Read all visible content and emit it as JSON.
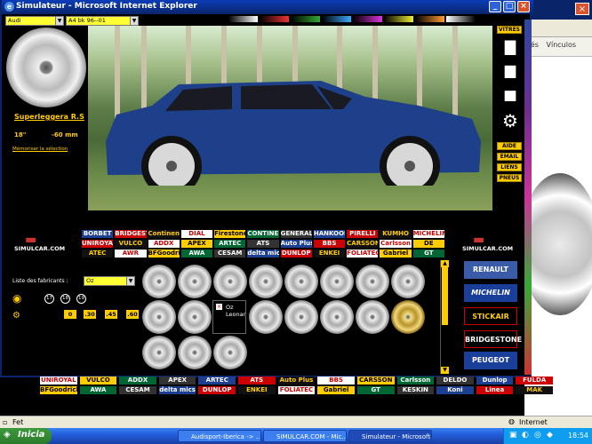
{
  "window": {
    "title": "Simulateur - Microsoft Internet Explorer",
    "minimize": "_",
    "maximize": "□",
    "close": "×"
  },
  "bg_browser": {
    "link1": "Vés",
    "link2": "Vínculos"
  },
  "top_selects": {
    "make": "Audi",
    "model": "A4 bk 96--01"
  },
  "wheel_info": {
    "name": "Superleggera R.S",
    "size": "18\"",
    "offset": "-60 mm",
    "memorize_link": "Mémoriser la sélection"
  },
  "right_menu": {
    "vitres": "VITRES",
    "aide": "AIDE",
    "email": "EMAIL",
    "liens": "LIENS",
    "pneus": "PNEUS"
  },
  "site_logo": "SIMULCAR.COM",
  "site_logo_right": "SIMULCAR.COM",
  "manufacturers": {
    "label": "Liste des fabricants :",
    "selected": "Oz",
    "rim_sizes": [
      "17",
      "18",
      "19"
    ],
    "offsets": [
      "0",
      ".30",
      ".45",
      ".60"
    ]
  },
  "wheel_missing_label": "Oz Leonar",
  "logo_rows": [
    [
      "BORBET",
      "BRIDGESTONE",
      "Continental",
      "DIAL",
      "Firestone",
      "CONTINENTAL",
      "GENERAL TIRE",
      "HANKOOK",
      "PIRELLI",
      "KUMHO",
      "MICHELIN"
    ],
    [
      "UNIROYAL",
      "VULCO",
      "ADDX",
      "APEX",
      "ARTEC",
      "ATS",
      "Auto Plus",
      "BBS",
      "CARSSON",
      "Carlsson",
      "DE"
    ],
    [
      "ATEC",
      "AWR",
      "BFGoodrich",
      "AWA",
      "CESAM",
      "delta mics",
      "DUNLOP",
      "ENKEI",
      "FOLIATEC",
      "Gabriel",
      "GT"
    ]
  ],
  "brands_right": [
    "RENAULT",
    "MICHELIN",
    "STICKAIR",
    "BRIDGESTONE",
    "PEUGEOT"
  ],
  "bottom_logos": [
    [
      "UNIROYAL",
      "VULCO",
      "ADDX",
      "APEX",
      "ARTEC",
      "ATS",
      "Auto Plus",
      "BBS",
      "CARSSON",
      "Carlsson",
      "DELDO",
      "Dunlop",
      "FULDA"
    ],
    [
      "BFGoodrich",
      "AWA",
      "CESAM",
      "delta mics",
      "DUNLOP",
      "ENKEI",
      "FOLIATEC",
      "Gabriel",
      "GT",
      "KESKIN",
      "Koni",
      "Linea",
      "MAK"
    ]
  ],
  "statusbar": {
    "left": "Fet",
    "zone": "Internet"
  },
  "taskbar": {
    "start": "Inicia",
    "tasks": [
      "Audisport-Iberica -> ...",
      "SIMULCAR.COM - Mic...",
      "Simulateur - Microsoft..."
    ],
    "clock": "18:54"
  },
  "colors": {
    "accent_yellow": "#ffcc00",
    "title_blue": "#0a246a",
    "car_blue": "#1e3f8a"
  }
}
